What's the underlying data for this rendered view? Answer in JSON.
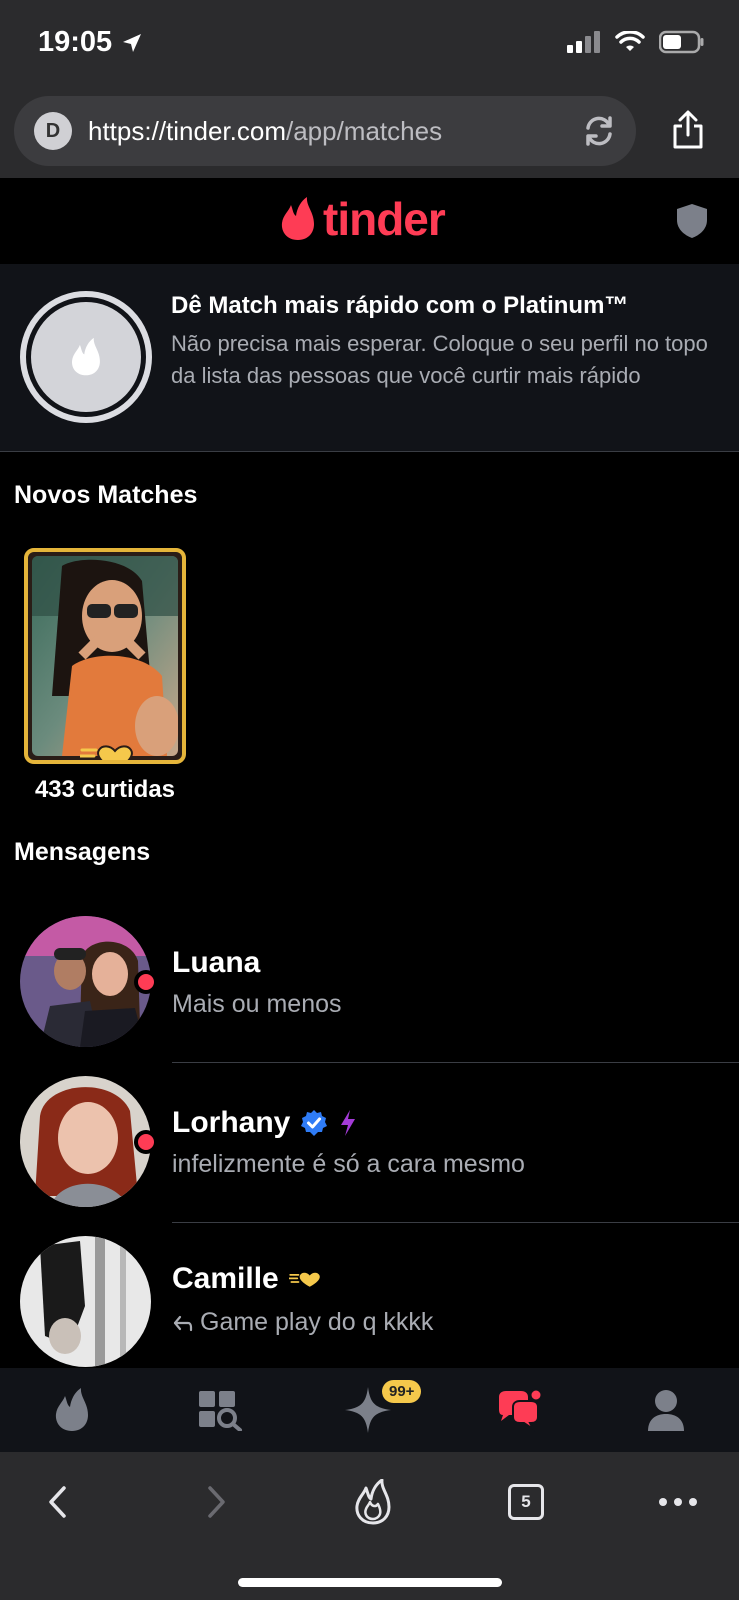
{
  "status": {
    "time": "19:05"
  },
  "browser": {
    "favicon_letter": "D",
    "url_host": "https://tinder.com",
    "url_path": "/app/matches",
    "tab_count": "5"
  },
  "app": {
    "logo_text": "tinder",
    "brand_color": "#fe3c55"
  },
  "promo": {
    "title": "Dê Match mais rápido com o Platinum™",
    "description": "Não precisa mais esperar. Coloque o seu perfil no topo da lista das pessoas que você curtir mais rápido"
  },
  "new_matches": {
    "title": "Novos Matches",
    "likes_label": "433 curtidas"
  },
  "messages": {
    "title": "Mensagens",
    "items": [
      {
        "name": "Luana",
        "preview": "Mais ou menos",
        "online": true
      },
      {
        "name": "Lorhany",
        "preview": "infelizmente é só a cara mesmo",
        "online": true,
        "verified": true,
        "boost": true
      },
      {
        "name": "Camille",
        "preview": "Game play do q kkkk",
        "replied": true,
        "super_like": true
      }
    ]
  },
  "bottom_nav": {
    "badge": "99+"
  }
}
